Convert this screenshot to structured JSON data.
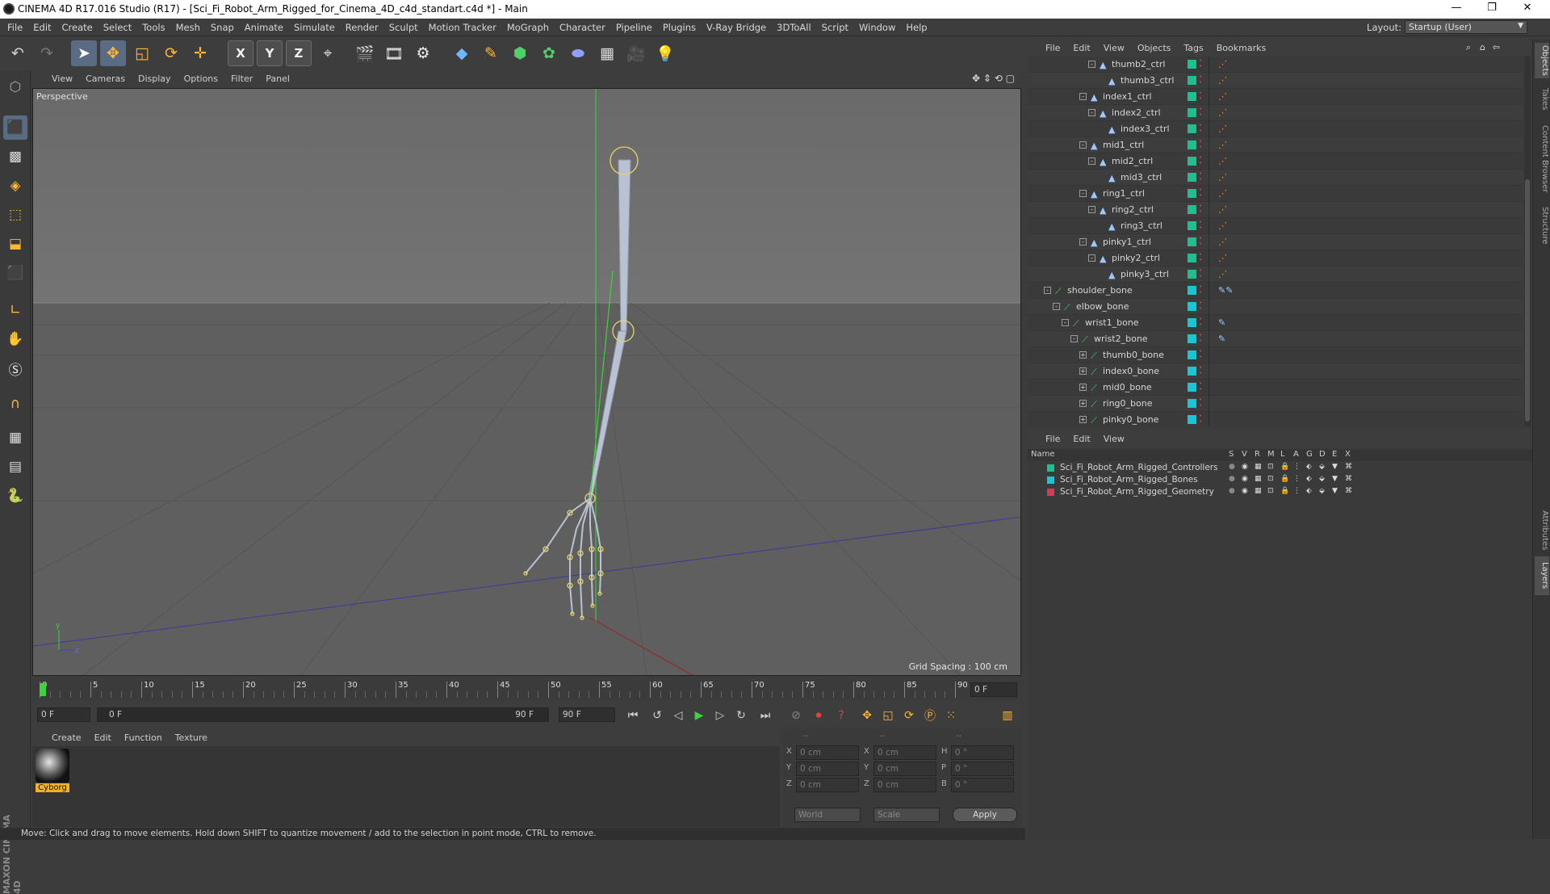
{
  "window": {
    "title": "CINEMA 4D R17.016 Studio (R17) - [Sci_Fi_Robot_Arm_Rigged_for_Cinema_4D_c4d_standart.c4d *] - Main",
    "minimize_glyph": "—",
    "restore_glyph": "❐",
    "close_glyph": "✕"
  },
  "menubar": {
    "items": [
      "File",
      "Edit",
      "Create",
      "Select",
      "Tools",
      "Mesh",
      "Snap",
      "Animate",
      "Simulate",
      "Render",
      "Sculpt",
      "Motion Tracker",
      "MoGraph",
      "Character",
      "Pipeline",
      "Plugins",
      "V-Ray Bridge",
      "3DToAll",
      "Script",
      "Window",
      "Help"
    ],
    "layout_label": "Layout:",
    "layout_value": "Startup (User)"
  },
  "toolbar": {
    "axis_x": "X",
    "axis_y": "Y",
    "axis_z": "Z"
  },
  "viewport": {
    "menu": [
      "View",
      "Cameras",
      "Display",
      "Options",
      "Filter",
      "Panel"
    ],
    "label": "Perspective",
    "grid_spacing": "Grid Spacing : 100 cm",
    "axis_y_label": "y",
    "axis_z_label": "z"
  },
  "timeline": {
    "ticks": [
      "0",
      "5",
      "10",
      "15",
      "20",
      "25",
      "30",
      "35",
      "40",
      "45",
      "50",
      "55",
      "60",
      "65",
      "70",
      "75",
      "80",
      "85",
      "90"
    ],
    "current_frame": "0 F",
    "start_field": "0 F",
    "range_start": "0 F",
    "range_end": "90 F",
    "end_field": "90 F"
  },
  "material_manager": {
    "menu": [
      "Create",
      "Edit",
      "Function",
      "Texture"
    ],
    "materials": [
      {
        "name": "Cyborg"
      }
    ]
  },
  "coordinates": {
    "header": [
      "--",
      "--",
      "--"
    ],
    "rows": [
      {
        "a": "X",
        "av": "0 cm",
        "b": "X",
        "bv": "0 cm",
        "c": "H",
        "cv": "0 °"
      },
      {
        "a": "Y",
        "av": "0 cm",
        "b": "Y",
        "bv": "0 cm",
        "c": "P",
        "cv": "0 °"
      },
      {
        "a": "Z",
        "av": "0 cm",
        "b": "Z",
        "bv": "0 cm",
        "c": "B",
        "cv": "0 °"
      }
    ],
    "space": "World",
    "mode": "Scale",
    "apply": "Apply"
  },
  "status": {
    "text": "Move: Click and drag to move elements. Hold down SHIFT to quantize movement / add to the selection in point mode, CTRL to remove."
  },
  "brand": "MAXON CINEMA 4D",
  "object_manager": {
    "menu": [
      "File",
      "Edit",
      "View",
      "Objects",
      "Tags",
      "Bookmarks"
    ],
    "rows": [
      {
        "name": "thumb2_ctrl",
        "depth": 7,
        "type": "ctrl",
        "fold": "-",
        "layer": "#1fbf8f",
        "tag": "ik"
      },
      {
        "name": "thumb3_ctrl",
        "depth": 8,
        "type": "ctrl",
        "fold": "",
        "layer": "#1fbf8f",
        "tag": "ik"
      },
      {
        "name": "index1_ctrl",
        "depth": 6,
        "type": "ctrl",
        "fold": "-",
        "layer": "#1fbf8f",
        "tag": "ik"
      },
      {
        "name": "index2_ctrl",
        "depth": 7,
        "type": "ctrl",
        "fold": "-",
        "layer": "#1fbf8f",
        "tag": "ik"
      },
      {
        "name": "index3_ctrl",
        "depth": 8,
        "type": "ctrl",
        "fold": "",
        "layer": "#1fbf8f",
        "tag": "ik"
      },
      {
        "name": "mid1_ctrl",
        "depth": 6,
        "type": "ctrl",
        "fold": "-",
        "layer": "#1fbf8f",
        "tag": "ik"
      },
      {
        "name": "mid2_ctrl",
        "depth": 7,
        "type": "ctrl",
        "fold": "-",
        "layer": "#1fbf8f",
        "tag": "ik"
      },
      {
        "name": "mid3_ctrl",
        "depth": 8,
        "type": "ctrl",
        "fold": "",
        "layer": "#1fbf8f",
        "tag": "ik"
      },
      {
        "name": "ring1_ctrl",
        "depth": 6,
        "type": "ctrl",
        "fold": "-",
        "layer": "#1fbf8f",
        "tag": "ik"
      },
      {
        "name": "ring2_ctrl",
        "depth": 7,
        "type": "ctrl",
        "fold": "-",
        "layer": "#1fbf8f",
        "tag": "ik"
      },
      {
        "name": "ring3_ctrl",
        "depth": 8,
        "type": "ctrl",
        "fold": "",
        "layer": "#1fbf8f",
        "tag": "ik"
      },
      {
        "name": "pinky1_ctrl",
        "depth": 6,
        "type": "ctrl",
        "fold": "-",
        "layer": "#1fbf8f",
        "tag": "ik"
      },
      {
        "name": "pinky2_ctrl",
        "depth": 7,
        "type": "ctrl",
        "fold": "-",
        "layer": "#1fbf8f",
        "tag": "ik"
      },
      {
        "name": "pinky3_ctrl",
        "depth": 8,
        "type": "ctrl",
        "fold": "",
        "layer": "#1fbf8f",
        "tag": "ik"
      },
      {
        "name": "shoulder_bone",
        "depth": 2,
        "type": "bone",
        "fold": "-",
        "layer": "#19c6d6",
        "tag": "joint2"
      },
      {
        "name": "elbow_bone",
        "depth": 3,
        "type": "bone",
        "fold": "-",
        "layer": "#19c6d6",
        "tag": ""
      },
      {
        "name": "wrist1_bone",
        "depth": 4,
        "type": "bone",
        "fold": "-",
        "layer": "#19c6d6",
        "tag": "joint"
      },
      {
        "name": "wrist2_bone",
        "depth": 5,
        "type": "bone",
        "fold": "-",
        "layer": "#19c6d6",
        "tag": "joint"
      },
      {
        "name": "thumb0_bone",
        "depth": 6,
        "type": "bone",
        "fold": "+",
        "layer": "#19c6d6",
        "tag": ""
      },
      {
        "name": "index0_bone",
        "depth": 6,
        "type": "bone",
        "fold": "+",
        "layer": "#19c6d6",
        "tag": ""
      },
      {
        "name": "mid0_bone",
        "depth": 6,
        "type": "bone",
        "fold": "+",
        "layer": "#19c6d6",
        "tag": ""
      },
      {
        "name": "ring0_bone",
        "depth": 6,
        "type": "bone",
        "fold": "+",
        "layer": "#19c6d6",
        "tag": ""
      },
      {
        "name": "pinky0_bone",
        "depth": 6,
        "type": "bone",
        "fold": "+",
        "layer": "#19c6d6",
        "tag": ""
      }
    ]
  },
  "layer_manager": {
    "menu": [
      "File",
      "Edit",
      "View"
    ],
    "columns": [
      "Name",
      "S",
      "V",
      "R",
      "M",
      "L",
      "A",
      "G",
      "D",
      "E",
      "X"
    ],
    "layers": [
      {
        "name": "Sci_Fi_Robot_Arm_Rigged_Controllers",
        "color": "#1fbf8f"
      },
      {
        "name": "Sci_Fi_Robot_Arm_Rigged_Bones",
        "color": "#19c6d6"
      },
      {
        "name": "Sci_Fi_Robot_Arm_Rigged_Geometry",
        "color": "#d6385a"
      }
    ]
  },
  "right_tabs": [
    "Objects",
    "Takes",
    "Content Browser",
    "Structure",
    "Attributes",
    "Layers"
  ],
  "colors": {
    "accent_selected": "#5a6b84",
    "viewport_bg": "#6a6a6a",
    "bone_fill": "#b9c2d3",
    "joint_ring": "#e7d36a"
  }
}
